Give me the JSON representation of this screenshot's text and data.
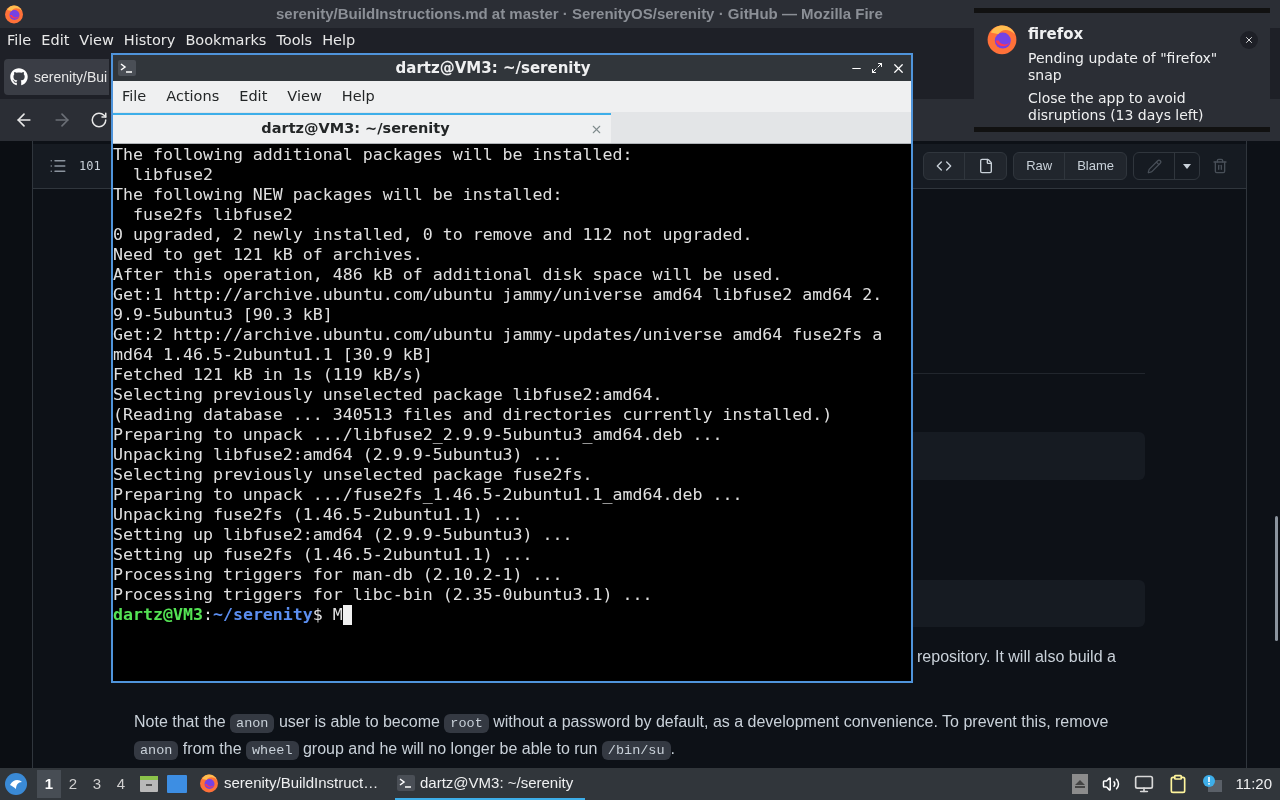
{
  "browser": {
    "title": "serenity/BuildInstructions.md at master · SerenityOS/serenity · GitHub — Mozilla Fire",
    "menu": [
      "File",
      "Edit",
      "View",
      "History",
      "Bookmarks",
      "Tools",
      "Help"
    ],
    "tab": {
      "title": "serenity/Bui"
    },
    "file_header": {
      "line_count": "101",
      "buttons": [
        "Raw",
        "Blame"
      ]
    },
    "partial_line": "repository. It will also build a",
    "note_lines": [
      [
        {
          "kind": "text",
          "text": "Note that the "
        },
        {
          "kind": "code",
          "text": "anon"
        },
        {
          "kind": "text",
          "text": " user is able to become "
        },
        {
          "kind": "code",
          "text": "root"
        },
        {
          "kind": "text",
          "text": " without a password by default, as a development convenience. To prevent this, remove"
        }
      ],
      [
        {
          "kind": "code",
          "text": "anon"
        },
        {
          "kind": "text",
          "text": " from the "
        },
        {
          "kind": "code",
          "text": "wheel"
        },
        {
          "kind": "text",
          "text": " group and he will no longer be able to run "
        },
        {
          "kind": "code",
          "text": "/bin/su"
        },
        {
          "kind": "text",
          "text": "."
        }
      ]
    ]
  },
  "terminal": {
    "title": "dartz@VM3: ~/serenity",
    "menu": [
      "File",
      "Actions",
      "Edit",
      "View",
      "Help"
    ],
    "tab": {
      "title": "dartz@VM3: ~/serenity"
    },
    "lines": [
      "The following additional packages will be installed:",
      "  libfuse2",
      "The following NEW packages will be installed:",
      "  fuse2fs libfuse2",
      "0 upgraded, 2 newly installed, 0 to remove and 112 not upgraded.",
      "Need to get 121 kB of archives.",
      "After this operation, 486 kB of additional disk space will be used.",
      "Get:1 http://archive.ubuntu.com/ubuntu jammy/universe amd64 libfuse2 amd64 2.",
      "9.9-5ubuntu3 [90.3 kB]",
      "Get:2 http://archive.ubuntu.com/ubuntu jammy-updates/universe amd64 fuse2fs a",
      "md64 1.46.5-2ubuntu1.1 [30.9 kB]",
      "Fetched 121 kB in 1s (119 kB/s)",
      "Selecting previously unselected package libfuse2:amd64.",
      "(Reading database ... 340513 files and directories currently installed.)",
      "Preparing to unpack .../libfuse2_2.9.9-5ubuntu3_amd64.deb ...",
      "Unpacking libfuse2:amd64 (2.9.9-5ubuntu3) ...",
      "Selecting previously unselected package fuse2fs.",
      "Preparing to unpack .../fuse2fs_1.46.5-2ubuntu1.1_amd64.deb ...",
      "Unpacking fuse2fs (1.46.5-2ubuntu1.1) ...",
      "Setting up libfuse2:amd64 (2.9.9-5ubuntu3) ...",
      "Setting up fuse2fs (1.46.5-2ubuntu1.1) ...",
      "Processing triggers for man-db (2.10.2-1) ...",
      "Processing triggers for libc-bin (2.35-0ubuntu3.1) ..."
    ],
    "prompt": {
      "user_host": "dartz@VM3",
      "separator": ":",
      "path": "~/serenity",
      "symbol": "$",
      "input": "M"
    }
  },
  "notification": {
    "app": "firefox",
    "summary": "Pending update of \"firefox\" snap",
    "body": "Close the app to avoid disruptions (13 days left)"
  },
  "taskbar": {
    "workspaces": [
      {
        "label": "1",
        "selected": true
      },
      {
        "label": "2",
        "selected": false
      },
      {
        "label": "3",
        "selected": false
      },
      {
        "label": "4",
        "selected": false
      }
    ],
    "tasks": [
      {
        "kind": "browser",
        "title": "serenity/BuildInstruct…",
        "selected": false
      },
      {
        "kind": "terminal",
        "title": "dartz@VM3: ~/serenity",
        "selected": true
      }
    ],
    "clock": "11:20"
  }
}
